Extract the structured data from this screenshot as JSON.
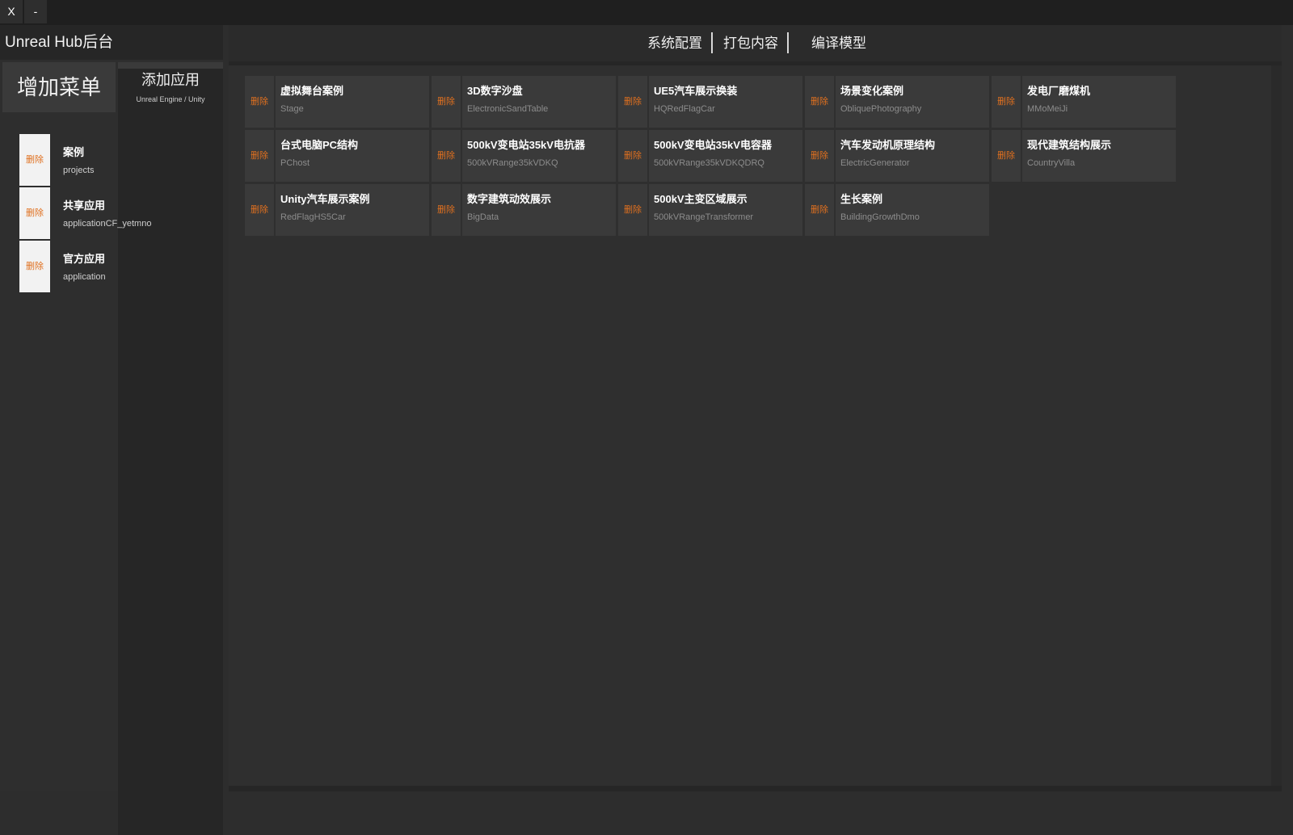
{
  "window": {
    "close_label": "X",
    "minimize_label": "-"
  },
  "sidebar": {
    "title": "Unreal Hub后台",
    "add_menu_label": "增加菜单",
    "add_app_label": "添加应用",
    "add_app_sub": "Unreal Engine / Unity",
    "items": [
      {
        "delete_label": "删除",
        "name": "案例",
        "id": "projects"
      },
      {
        "delete_label": "删除",
        "name": "共享应用",
        "id": "applicationCF_yetmno"
      },
      {
        "delete_label": "删除",
        "name": "官方应用",
        "id": "application"
      }
    ]
  },
  "nav": {
    "items": [
      {
        "label": "系统配置"
      },
      {
        "label": "打包内容"
      },
      {
        "label": "编译模型"
      }
    ]
  },
  "cards": [
    {
      "delete_label": "删除",
      "title": "虚拟舞台案例",
      "sub": "Stage"
    },
    {
      "delete_label": "删除",
      "title": "3D数字沙盘",
      "sub": "ElectronicSandTable"
    },
    {
      "delete_label": "删除",
      "title": "UE5汽车展示换装",
      "sub": "HQRedFlagCar"
    },
    {
      "delete_label": "删除",
      "title": "场景变化案例",
      "sub": "ObliquePhotography"
    },
    {
      "delete_label": "删除",
      "title": "发电厂磨煤机",
      "sub": "MMoMeiJi"
    },
    {
      "delete_label": "删除",
      "title": "台式电脑PC结构",
      "sub": "PChost"
    },
    {
      "delete_label": "删除",
      "title": "500kV变电站35kV电抗器",
      "sub": "500kVRange35kVDKQ"
    },
    {
      "delete_label": "删除",
      "title": "500kV变电站35kV电容器",
      "sub": "500kVRange35kVDKQDRQ"
    },
    {
      "delete_label": "删除",
      "title": "汽车发动机原理结构",
      "sub": "ElectricGenerator"
    },
    {
      "delete_label": "删除",
      "title": "现代建筑结构展示",
      "sub": "CountryVilla"
    },
    {
      "delete_label": "删除",
      "title": "Unity汽车展示案例",
      "sub": "RedFlagHS5Car"
    },
    {
      "delete_label": "删除",
      "title": "数字建筑动效展示",
      "sub": "BigData"
    },
    {
      "delete_label": "删除",
      "title": "500kV主变区域展示",
      "sub": "500kVRangeTransformer"
    },
    {
      "delete_label": "删除",
      "title": "生长案例",
      "sub": "BuildingGrowthDmo"
    }
  ],
  "colors": {
    "delete_text": "#e0701f",
    "background": "#2d2d2d",
    "card_bg": "#3a3a3a"
  }
}
